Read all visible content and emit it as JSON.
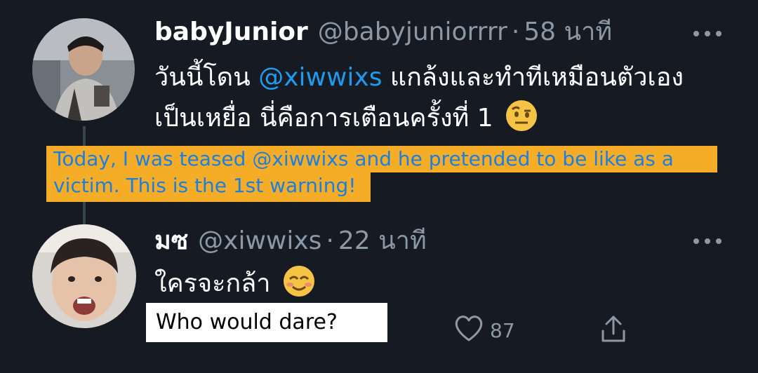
{
  "tweet1": {
    "display_name": "babyJunior",
    "handle": "@babyjuniorrrr",
    "separator": "·",
    "time": "58 นาที",
    "text_before_mention": "วันนี้โดน ",
    "mention": "@xiwwixs",
    "text_after_mention": " แกล้งและทำทีเหมือนตัวเองเป็นเหยื่อ นี่คือการเตือนครั้งที่ 1",
    "emoji": "raised-eyebrow-face",
    "caption_line1": "Today, I was teased @xiwwixs and he pretended to be like as a",
    "caption_line2": "victim. This is the 1st warning!"
  },
  "tweet2": {
    "display_name": "มซ",
    "handle": "@xiwwixs",
    "separator": "·",
    "time": "22 นาที",
    "text": "ใครจะกล้า",
    "emoji": "smiling-face",
    "caption": "Who would dare?",
    "like_count": "87"
  },
  "colors": {
    "background": "#151a23",
    "mention": "#1d9bf0",
    "muted": "#8b98a5",
    "caption_bg": "#f5ad28",
    "caption_text": "#1b7fe0"
  }
}
